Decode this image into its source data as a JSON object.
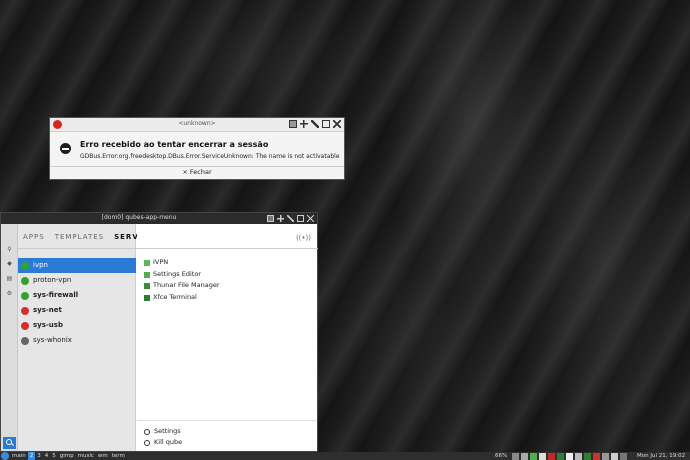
{
  "colors": {
    "accent": "#2a7bd4",
    "dialog_red": "#d9261c",
    "qube_green": "#35a12d",
    "qube_red": "#d32f2f",
    "qube_gray": "#666666"
  },
  "dialog": {
    "title": "<unknown>",
    "heading": "Erro recebido ao tentar encerrar a sessão",
    "message": "GDBus.Error:org.freedesktop.DBus.Error.ServiceUnknown: The name is not activatable",
    "close_label": "× Fechar"
  },
  "app_menu": {
    "title": "[dom0] qubes-app-menu",
    "tabs": [
      {
        "label": "APPS",
        "active": false
      },
      {
        "label": "TEMPLATES",
        "active": false
      },
      {
        "label": "SERVICE",
        "active": true
      }
    ],
    "sidebar_icons": [
      "search-icon",
      "cube-icon",
      "document-icon",
      "gear-icon"
    ],
    "qubes": [
      {
        "label": "ivpn",
        "color": "green",
        "bold": false,
        "selected": true
      },
      {
        "label": "proton-vpn",
        "color": "green",
        "bold": false,
        "selected": false
      },
      {
        "label": "sys-firewall",
        "color": "green",
        "bold": true,
        "selected": false
      },
      {
        "label": "sys-net",
        "color": "red",
        "bold": true,
        "selected": false
      },
      {
        "label": "sys-usb",
        "color": "red",
        "bold": true,
        "selected": false
      },
      {
        "label": "sys-whonix",
        "color": "gray",
        "bold": false,
        "selected": false
      }
    ],
    "apps": [
      {
        "label": "IVPN",
        "icon": "ivpn-icon"
      },
      {
        "label": "Settings Editor",
        "icon": "settings-editor-icon"
      },
      {
        "label": "Thunar File Manager",
        "icon": "file-manager-icon"
      },
      {
        "label": "Xfce Terminal",
        "icon": "terminal-icon"
      }
    ],
    "settings": [
      {
        "label": "Settings",
        "icon": "settings-icon"
      },
      {
        "label": "Kill qube",
        "icon": "kill-icon"
      }
    ]
  },
  "taskbar": {
    "start_label": "main",
    "workspaces": [
      "2",
      "3",
      "4",
      "5"
    ],
    "items": [
      "gimp",
      "music",
      "wm",
      "term"
    ],
    "status": "66%",
    "clock": "Mon Jul 21, 19:02"
  }
}
